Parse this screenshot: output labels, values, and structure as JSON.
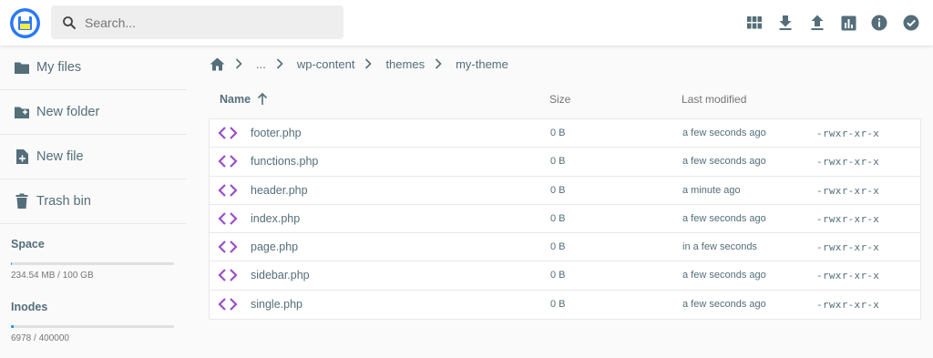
{
  "search": {
    "placeholder": "Search..."
  },
  "toolbar": [
    {
      "name": "switch-view-button",
      "icon": "grid-icon"
    },
    {
      "name": "download-button",
      "icon": "download-icon"
    },
    {
      "name": "upload-button",
      "icon": "upload-icon"
    },
    {
      "name": "info-chart-button",
      "icon": "bar-chart-icon"
    },
    {
      "name": "info-button",
      "icon": "info-icon"
    },
    {
      "name": "select-button",
      "icon": "check-circle-icon"
    }
  ],
  "sidebar": {
    "items": [
      {
        "label": "My files",
        "icon": "folder-icon"
      },
      {
        "label": "New folder",
        "icon": "folder-plus-icon"
      },
      {
        "label": "New file",
        "icon": "file-plus-icon"
      },
      {
        "label": "Trash bin",
        "icon": "trash-icon"
      }
    ],
    "space": {
      "title": "Space",
      "text": "234.54 MB / 100 GB",
      "fill": 0.0023
    },
    "inodes": {
      "title": "Inodes",
      "text": "6978 / 400000",
      "fill": 0.0174
    }
  },
  "breadcrumb": {
    "items": [
      "...",
      "wp-content",
      "themes",
      "my-theme"
    ]
  },
  "table": {
    "headers": {
      "name": "Name",
      "size": "Size",
      "modified": "Last modified"
    },
    "rows": [
      {
        "name": "footer.php",
        "size": "0 B",
        "modified": "a few seconds ago",
        "perm": "-rwxr-xr-x"
      },
      {
        "name": "functions.php",
        "size": "0 B",
        "modified": "a few seconds ago",
        "perm": "-rwxr-xr-x"
      },
      {
        "name": "header.php",
        "size": "0 B",
        "modified": "a minute ago",
        "perm": "-rwxr-xr-x"
      },
      {
        "name": "index.php",
        "size": "0 B",
        "modified": "a few seconds ago",
        "perm": "-rwxr-xr-x"
      },
      {
        "name": "page.php",
        "size": "0 B",
        "modified": "in a few seconds",
        "perm": "-rwxr-xr-x"
      },
      {
        "name": "sidebar.php",
        "size": "0 B",
        "modified": "a few seconds ago",
        "perm": "-rwxr-xr-x"
      },
      {
        "name": "single.php",
        "size": "0 B",
        "modified": "a few seconds ago",
        "perm": "-rwxr-xr-x"
      }
    ]
  },
  "colors": {
    "accent": "#2979ff",
    "code_icon": "#9c4dcc",
    "text": "#546e7a"
  }
}
